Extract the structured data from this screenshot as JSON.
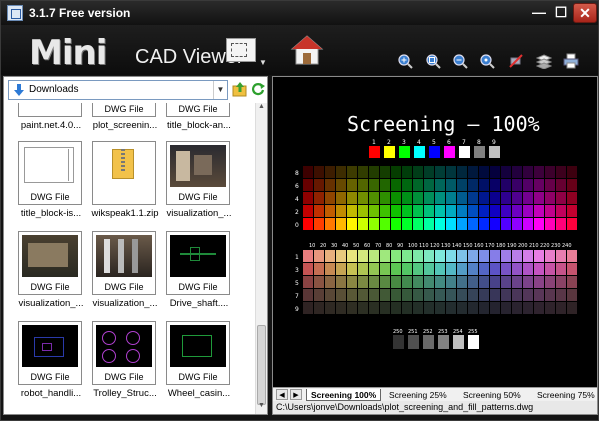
{
  "window": {
    "title": "3.1.7 Free version",
    "minimize": "—",
    "maximize": "☐",
    "close": "✕"
  },
  "toolbar": {
    "logo_main": "Mini",
    "logo_sub": "CAD Viewer",
    "tools": [
      "zoom-in-icon",
      "zoom-extents-icon",
      "zoom-out-icon",
      "zoom-window-icon",
      "pan-off-icon",
      "layers-icon",
      "print-icon"
    ]
  },
  "browser": {
    "folder": "Downloads",
    "files": [
      {
        "name": "paint.net.4.0...",
        "tag": "",
        "kind": "partial-blank"
      },
      {
        "name": "plot_screenin...",
        "tag": "DWG File",
        "kind": "partial-blank"
      },
      {
        "name": "title_block-an...",
        "tag": "DWG File",
        "kind": "partial-blank"
      },
      {
        "name": "title_block-is...",
        "tag": "DWG File",
        "kind": "titleblock"
      },
      {
        "name": "wikspeak1.1.zip",
        "tag": "",
        "kind": "zip"
      },
      {
        "name": "visualization_...",
        "tag": "DWG File",
        "kind": "render1"
      },
      {
        "name": "visualization_...",
        "tag": "DWG File",
        "kind": "render2"
      },
      {
        "name": "visualization_...",
        "tag": "DWG File",
        "kind": "render3"
      },
      {
        "name": "Drive_shaft....",
        "tag": "DWG File",
        "kind": "dark-green"
      },
      {
        "name": "robot_handli...",
        "tag": "DWG File",
        "kind": "dark-blue"
      },
      {
        "name": "Trolley_Struc...",
        "tag": "DWG File",
        "kind": "dark-purple"
      },
      {
        "name": "Wheel_casin...",
        "tag": "DWG File",
        "kind": "dark-green2"
      }
    ]
  },
  "drawing": {
    "title": "Screening — 100%",
    "top_swatch_numbers": [
      "1",
      "2",
      "3",
      "4",
      "5",
      "6",
      "7",
      "8",
      "9"
    ],
    "top_swatch_colors": [
      "#ff0000",
      "#ffff00",
      "#00ff00",
      "#00ffff",
      "#0000ff",
      "#ff00ff",
      "#ffffff",
      "#808080",
      "#c0c0c0"
    ],
    "upper_row_labels": [
      "8",
      "6",
      "4",
      "2",
      "0"
    ],
    "lower_row_labels": [
      "1",
      "3",
      "5",
      "7",
      "9"
    ],
    "hue_labels": [
      "10",
      "20",
      "30",
      "40",
      "50",
      "60",
      "70",
      "80",
      "90",
      "100",
      "110",
      "120",
      "130",
      "140",
      "150",
      "160",
      "170",
      "180",
      "190",
      "200",
      "210",
      "220",
      "230",
      "240"
    ],
    "gray_labels": [
      "250",
      "251",
      "252",
      "253",
      "254",
      "255"
    ],
    "gray_colors": [
      "#333333",
      "#505050",
      "#696969",
      "#828282",
      "#bebebe",
      "#ffffff"
    ]
  },
  "tabs": {
    "items": [
      "Screening 100%",
      "Screening 25%",
      "Screening 50%",
      "Screening 75%"
    ],
    "active": 0
  },
  "status": {
    "path": "C:\\Users\\jonve\\Downloads\\plot_screening_and_fill_patterns.dwg"
  }
}
